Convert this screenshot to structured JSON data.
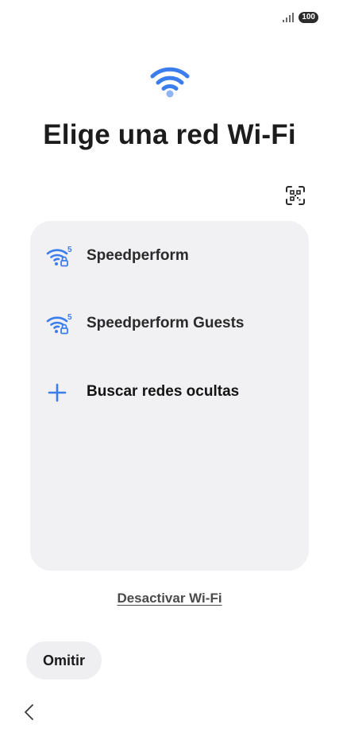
{
  "status_bar": {
    "signal_icon": "signal-bars-icon",
    "battery_level": "100"
  },
  "header": {
    "hero_icon": "wifi-icon",
    "title": "Elige una red Wi-Fi"
  },
  "toolbar": {
    "qr_icon": "qr-code-scan-icon"
  },
  "networks": [
    {
      "name": "Speedperform",
      "icon": "wifi-5ghz-locked-icon",
      "band": "5"
    },
    {
      "name": "Speedperform Guests",
      "icon": "wifi-5ghz-locked-icon",
      "band": "5"
    }
  ],
  "hidden_networks": {
    "label": "Buscar redes ocultas",
    "icon": "plus-icon"
  },
  "actions": {
    "disable_wifi": "Desactivar Wi-Fi",
    "skip": "Omitir",
    "back_icon": "chevron-left-icon"
  },
  "colors": {
    "accent": "#3b7ded",
    "card_background": "#f1f1f3",
    "button_background": "#efeff1"
  }
}
